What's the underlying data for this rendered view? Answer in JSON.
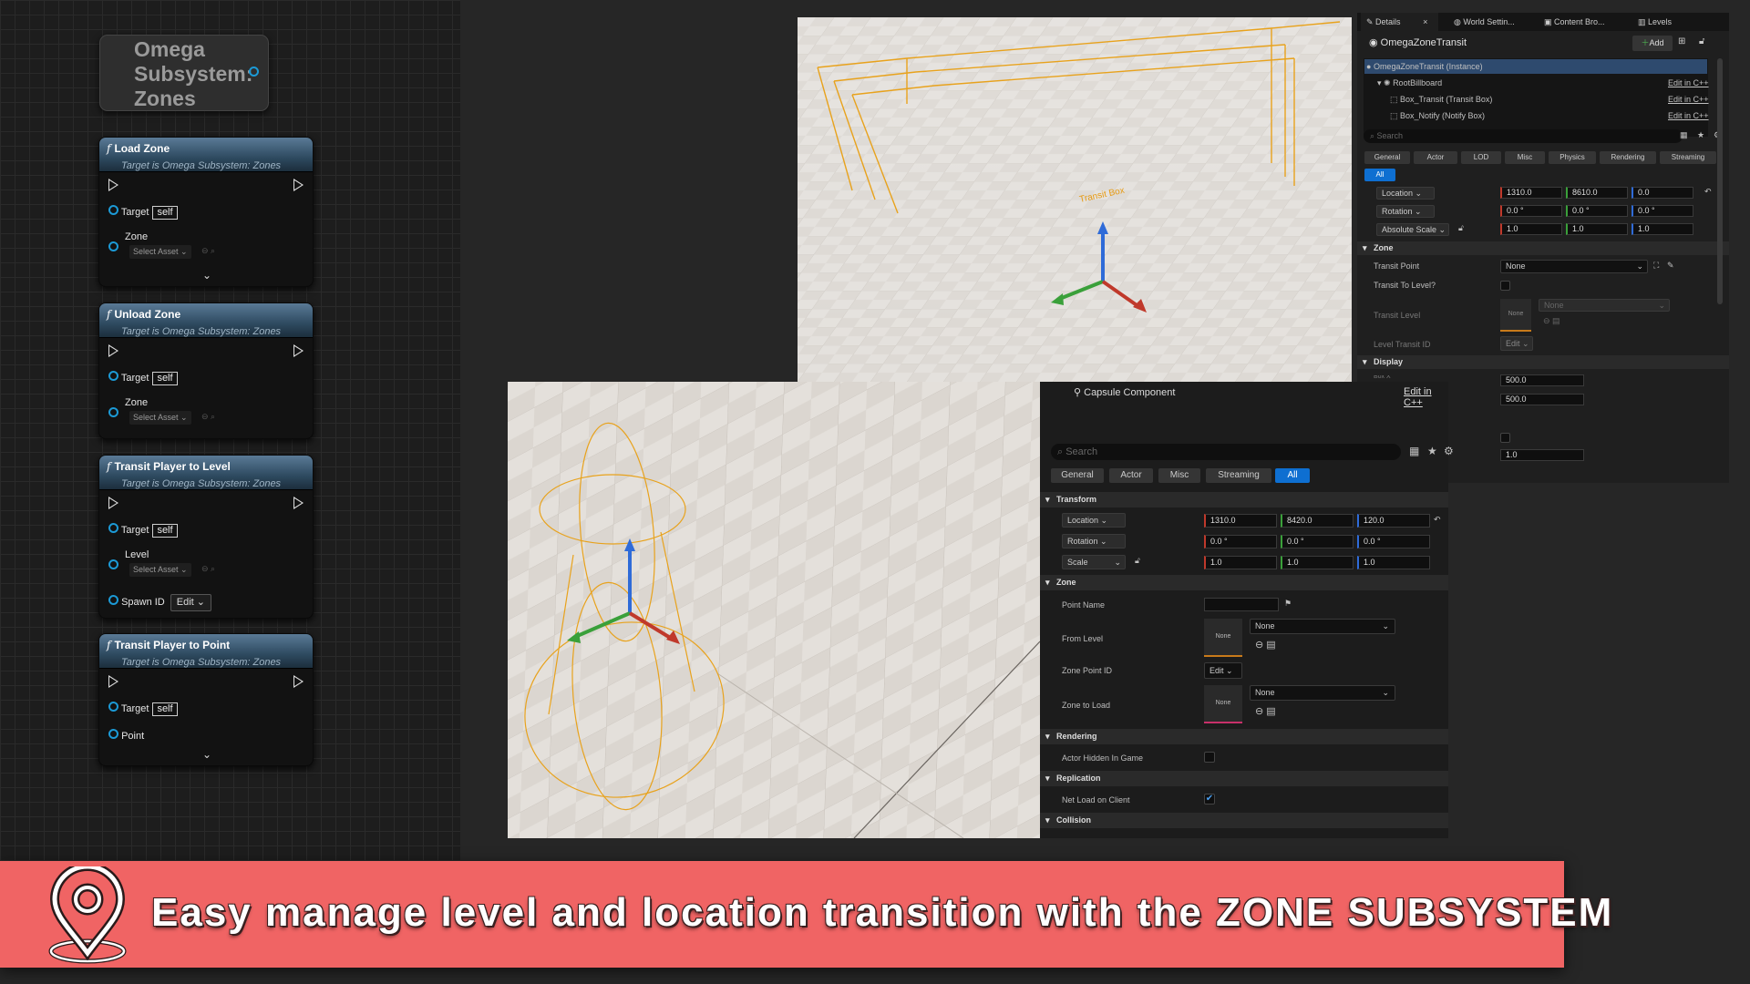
{
  "graph": {
    "subsystem_title": "Omega Subsystem: Zones",
    "nodes": [
      {
        "title": "Load Zone",
        "subtitle": "Target is Omega Subsystem: Zones",
        "pin1": "Target",
        "self": "self",
        "pin2": "Zone",
        "asset": "Select Asset"
      },
      {
        "title": "Unload Zone",
        "subtitle": "Target is Omega Subsystem: Zones",
        "pin1": "Target",
        "self": "self",
        "pin2": "Zone",
        "asset": "Select Asset"
      },
      {
        "title": "Transit Player to Level",
        "subtitle": "Target is Omega Subsystem: Zones",
        "pin1": "Target",
        "self": "self",
        "pin2": "Level",
        "asset": "Select Asset",
        "pin3": "Spawn ID",
        "edit": "Edit"
      },
      {
        "title": "Transit Player to Point",
        "subtitle": "Target is Omega Subsystem: Zones",
        "pin1": "Target",
        "self": "self",
        "pin2": "Point"
      }
    ]
  },
  "viewport_top": {
    "billboard_label": "Transit Box"
  },
  "details_top": {
    "tabs": [
      "Details",
      "World Settin...",
      "Content Bro...",
      "Levels"
    ],
    "actor_name": "OmegaZoneTransit",
    "add_label": "Add",
    "tree": [
      {
        "label": "OmegaZoneTransit (Instance)",
        "edit": ""
      },
      {
        "label": "RootBillboard",
        "edit": "Edit in C++"
      },
      {
        "label": "Box_Transit (Transit Box)",
        "edit": "Edit in C++"
      },
      {
        "label": "Box_Notify (Notify Box)",
        "edit": "Edit in C++"
      }
    ],
    "search_placeholder": "Search",
    "filters": [
      "General",
      "Actor",
      "LOD",
      "Misc",
      "Physics",
      "Rendering",
      "Streaming",
      "All"
    ],
    "location": {
      "label": "Location",
      "x": "1310.0",
      "y": "8610.0",
      "z": "0.0"
    },
    "rotation": {
      "label": "Rotation",
      "x": "0.0 °",
      "y": "0.0 °",
      "z": "0.0 °"
    },
    "scale": {
      "label": "Absolute Scale",
      "x": "1.0",
      "y": "1.0",
      "z": "1.0"
    },
    "zone_section": "Zone",
    "transit_point": {
      "label": "Transit Point",
      "value": "None"
    },
    "transit_to_level": "Transit To Level?",
    "transit_level": {
      "label": "Transit Level",
      "thumb": "None",
      "value": "None"
    },
    "level_transit_id": {
      "label": "Level Transit ID",
      "value": "Edit"
    },
    "display_section": "Display",
    "box_x_label": "Box X",
    "box_x": "500.0",
    "box_y": "500.0",
    "extra_value": "1.0"
  },
  "details_bottom": {
    "component_name": "Capsule Component",
    "edit_cpp": "Edit in C++",
    "search_placeholder": "Search",
    "filters": [
      "General",
      "Actor",
      "Misc",
      "Streaming",
      "All"
    ],
    "transform_section": "Transform",
    "location": {
      "label": "Location",
      "x": "1310.0",
      "y": "8420.0",
      "z": "120.0"
    },
    "rotation": {
      "label": "Rotation",
      "x": "0.0 °",
      "y": "0.0 °",
      "z": "0.0 °"
    },
    "scale": {
      "label": "Scale",
      "x": "1.0",
      "y": "1.0",
      "z": "1.0"
    },
    "zone_section": "Zone",
    "point_name": "Point Name",
    "from_level": {
      "label": "From Level",
      "thumb": "None",
      "value": "None"
    },
    "zone_point_id": {
      "label": "Zone Point ID",
      "value": "Edit"
    },
    "zone_to_load": {
      "label": "Zone to Load",
      "thumb": "None",
      "value": "None"
    },
    "rendering_section": "Rendering",
    "actor_hidden": "Actor Hidden In Game",
    "replication_section": "Replication",
    "net_load": "Net Load on Client",
    "collision_section": "Collision"
  },
  "banner": {
    "text": "Easy manage level and location transition with the ZONE SUBSYSTEM",
    "bg_color": "#f06464"
  },
  "icons": [
    "location-pin-icon",
    "function-icon",
    "exec-pin-icon",
    "data-pin-icon",
    "search-icon",
    "star-icon",
    "gear-icon",
    "grid-icon",
    "lock-icon",
    "reset-icon",
    "checkbox-icon",
    "folder-icon",
    "eyedropper-icon",
    "flag-icon"
  ]
}
